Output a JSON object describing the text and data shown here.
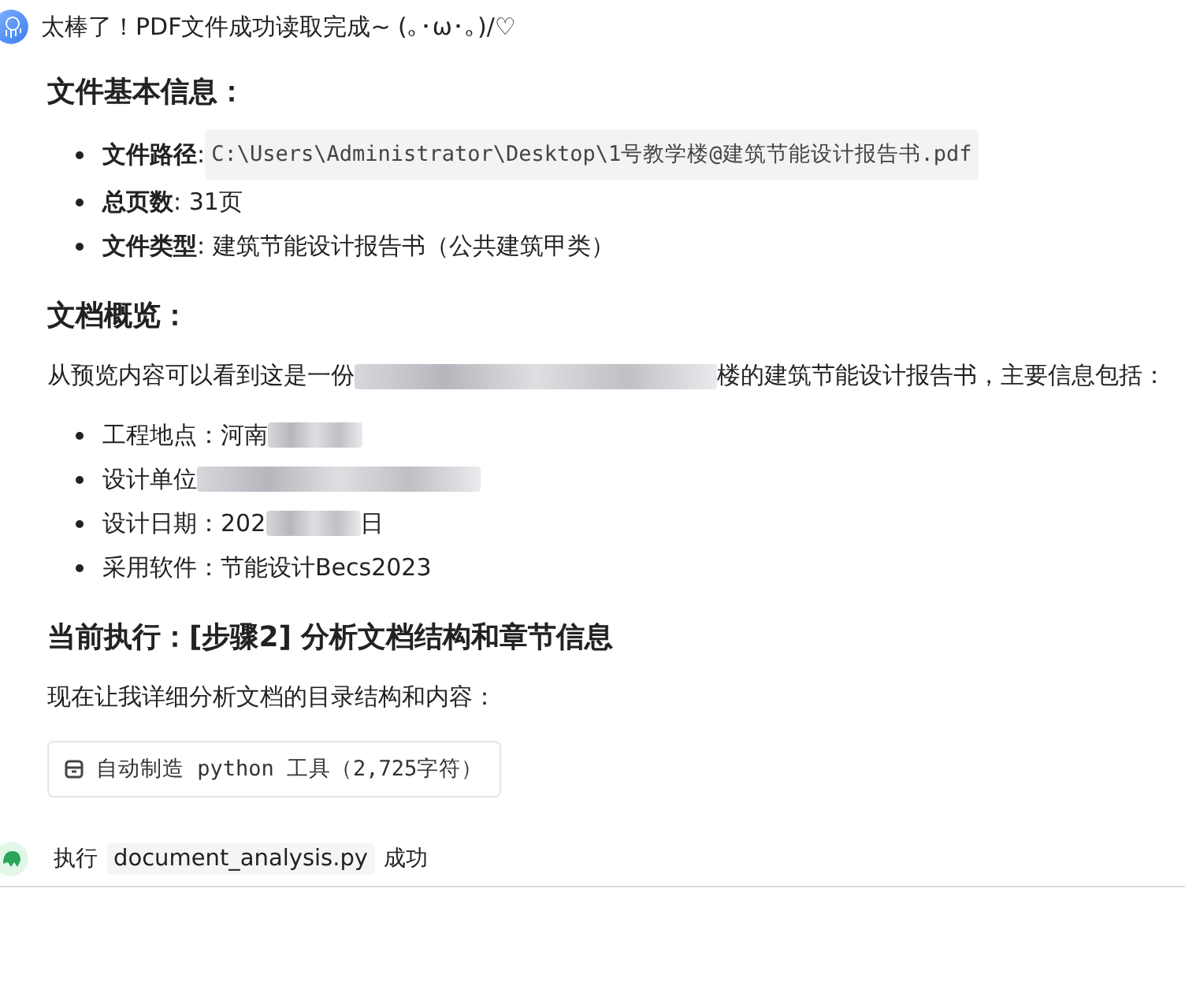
{
  "greeting": {
    "text": "太棒了！PDF文件成功读取完成~ (｡･ω･｡)/♡"
  },
  "sections": [
    {
      "kind": "heading",
      "text": "文件基本信息："
    },
    {
      "kind": "list",
      "items": [
        [
          {
            "kind": "bold",
            "text": "文件路径"
          },
          {
            "kind": "text",
            "text": ": "
          },
          {
            "kind": "code",
            "text": "C:\\Users\\Administrator\\Desktop\\1号教学楼@建筑节能设计报告书.pdf"
          }
        ],
        [
          {
            "kind": "bold",
            "text": "总页数"
          },
          {
            "kind": "text",
            "text": ": 31页"
          }
        ],
        [
          {
            "kind": "bold",
            "text": "文件类型"
          },
          {
            "kind": "text",
            "text": ": 建筑节能设计报告书（公共建筑甲类）"
          }
        ]
      ]
    },
    {
      "kind": "heading",
      "text": "文档概览："
    },
    {
      "kind": "paragraph",
      "items": [
        {
          "kind": "text",
          "text": "从预览内容可以看到这是一份"
        },
        {
          "kind": "smudge"
        },
        {
          "kind": "text",
          "text": "楼的建筑节能设计报告书，主要信息包括："
        }
      ]
    },
    {
      "kind": "list",
      "items": [
        [
          {
            "kind": "text",
            "text": "工程地点："
          },
          {
            "kind": "text",
            "text": "河南"
          },
          {
            "kind": "patch"
          }
        ],
        [
          {
            "kind": "text",
            "text": "设计单位"
          },
          {
            "kind": "blur"
          }
        ],
        [
          {
            "kind": "text",
            "text": "设计日期："
          },
          {
            "kind": "text",
            "text": "202"
          },
          {
            "kind": "patch"
          },
          {
            "kind": "text",
            "text": "日"
          }
        ],
        [
          {
            "kind": "text",
            "text": "采用软件："
          },
          {
            "kind": "text",
            "text": "节能设计Becs2023"
          }
        ]
      ]
    },
    {
      "kind": "heading",
      "text": "当前执行：[步骤2] 分析文档结构和章节信息"
    },
    {
      "kind": "paragraph",
      "items": [
        {
          "kind": "text",
          "text": "现在让我详细分析文档的目录结构和内容："
        }
      ]
    },
    {
      "kind": "tool",
      "text": "自动制造 python 工具（2,725字符）"
    }
  ],
  "footer": {
    "items": [
      {
        "kind": "text",
        "text": "执行"
      },
      {
        "kind": "code",
        "text": "document_analysis.py"
      },
      {
        "kind": "text",
        "text": "成功"
      }
    ]
  }
}
